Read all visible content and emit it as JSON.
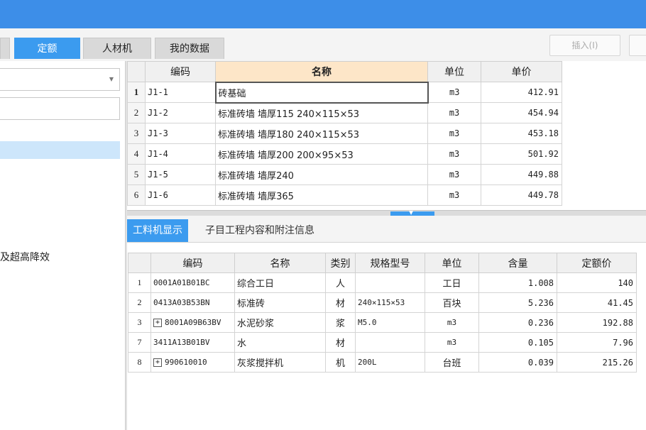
{
  "tabs": [
    {
      "label": "定额",
      "active": true
    },
    {
      "label": "人材机",
      "active": false
    },
    {
      "label": "我的数据",
      "active": false
    }
  ],
  "toolbar": {
    "insert_label": "插入(I)"
  },
  "left_panel": {
    "truncated_text": "及超高降效"
  },
  "quota_table": {
    "headers": [
      "",
      "编码",
      "名称",
      "单位",
      "单价"
    ],
    "rows": [
      {
        "n": "1",
        "code": "J1-1",
        "name": "砖基础",
        "unit": "m3",
        "price": "412.91"
      },
      {
        "n": "2",
        "code": "J1-2",
        "name": "标准砖墙 墙厚115 240×115×53",
        "unit": "m3",
        "price": "454.94"
      },
      {
        "n": "3",
        "code": "J1-3",
        "name": "标准砖墙 墙厚180 240×115×53",
        "unit": "m3",
        "price": "453.18"
      },
      {
        "n": "4",
        "code": "J1-4",
        "name": "标准砖墙 墙厚200 200×95×53",
        "unit": "m3",
        "price": "501.92"
      },
      {
        "n": "5",
        "code": "J1-5",
        "name": "标准砖墙 墙厚240",
        "unit": "m3",
        "price": "449.88"
      },
      {
        "n": "6",
        "code": "J1-6",
        "name": "标准砖墙 墙厚365",
        "unit": "m3",
        "price": "449.78"
      }
    ]
  },
  "bottom_tabs": [
    {
      "label": "工料机显示",
      "active": true
    },
    {
      "label": "子目工程内容和附注信息",
      "active": false
    }
  ],
  "material_table": {
    "headers": [
      "",
      "编码",
      "名称",
      "类别",
      "规格型号",
      "单位",
      "含量",
      "定额价"
    ],
    "rows": [
      {
        "n": "1",
        "code": "0001A01B01BC",
        "name": "综合工日",
        "cat": "人",
        "spec": "",
        "unit": "工日",
        "qty": "1.008",
        "price": "140"
      },
      {
        "n": "2",
        "code": "0413A03B53BN",
        "name": "标准砖",
        "cat": "材",
        "spec": "240×115×53",
        "unit": "百块",
        "qty": "5.236",
        "price": "41.45"
      },
      {
        "n": "3",
        "code": "8001A09B63BV",
        "name": "水泥砂浆",
        "cat": "浆",
        "spec": "M5.0",
        "unit": "m3",
        "qty": "0.236",
        "price": "192.88"
      },
      {
        "n": "7",
        "code": "3411A13B01BV",
        "name": "水",
        "cat": "材",
        "spec": "",
        "unit": "m3",
        "qty": "0.105",
        "price": "7.96"
      },
      {
        "n": "8",
        "code": "990610010",
        "name": "灰浆搅拌机",
        "cat": "机",
        "spec": "200L",
        "unit": "台班",
        "qty": "0.039",
        "price": "215.26"
      }
    ]
  },
  "colors": {
    "accent": "#3b9bef",
    "titlebar": "#3d8ee8",
    "name_header": "#fde6c8",
    "selection": "#cde6fb"
  }
}
